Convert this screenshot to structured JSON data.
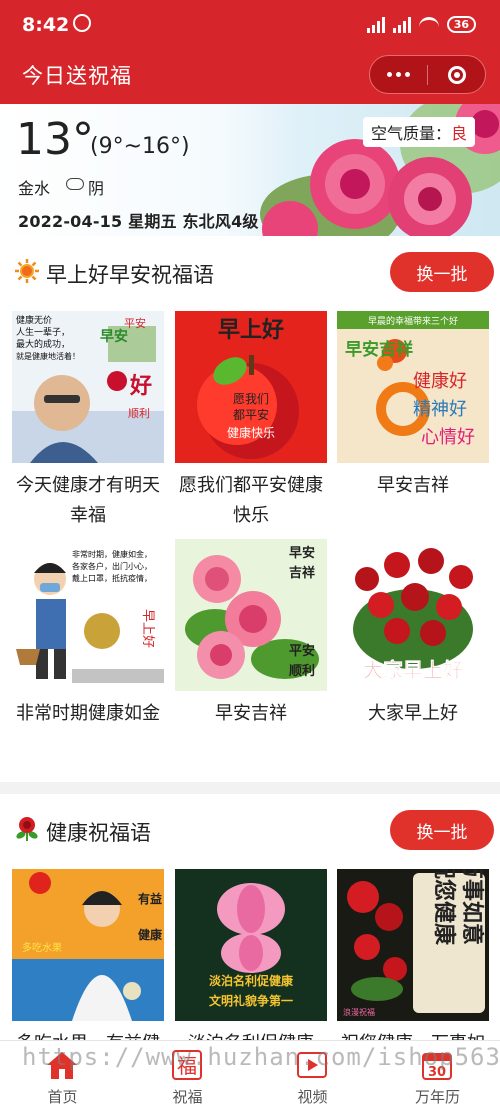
{
  "status": {
    "time": "8:42",
    "battery": "36"
  },
  "nav": {
    "title": "今日送祝福"
  },
  "weather": {
    "temp": "13°",
    "range": "(9°~16°)",
    "location": "金水",
    "condition": "阴",
    "date_line": "2022-04-15  星期五  东北风4级",
    "aq_label": "空气质量：",
    "aq_value": "良"
  },
  "sections": [
    {
      "title": "早上好早安祝福语",
      "more": "换一批",
      "items": [
        {
          "caption": "今天健康才有明天幸福",
          "art_text": [
            "健康无价",
            "人生一辈子，",
            "最大的成功，",
            "就是健康地活着！",
            "早安",
            "平安",
            "顺利",
            "好"
          ]
        },
        {
          "caption": "愿我们都平安健康快乐",
          "art_text": [
            "早上好",
            "愿我们",
            "都平安",
            "健康快乐"
          ]
        },
        {
          "caption": "早安吉祥",
          "art_text": [
            "早晨的幸福带来三个好",
            "早安吉祥",
            "健康好",
            "精神好",
            "心情好"
          ]
        },
        {
          "caption": "非常时期健康如金",
          "art_text": [
            "非常时期，健康如金，",
            "各家各户，出门小心，",
            "戴上口罩，抵抗疫情，",
            "早上好"
          ]
        },
        {
          "caption": "早安吉祥",
          "art_text": [
            "早安",
            "吉祥",
            "平安",
            "顺利"
          ]
        },
        {
          "caption": "大家早上好",
          "art_text": [
            "大家早上好"
          ]
        }
      ]
    },
    {
      "title": "健康祝福语",
      "more": "换一批",
      "items": [
        {
          "caption": "多吃水果，有益健康",
          "art_text": [
            "有益",
            "健康",
            "多吃水果"
          ]
        },
        {
          "caption": "淡泊名利促健康",
          "art_text": [
            "淡泊名利促健康",
            "文明礼貌争第一"
          ]
        },
        {
          "caption": "祝您健康，万事如意",
          "art_text": [
            "祝您健康",
            "万事如意",
            "浪漫祝福"
          ]
        }
      ]
    }
  ],
  "tabs": [
    {
      "label": "首页",
      "icon": "home-icon"
    },
    {
      "label": "祝福",
      "icon": "blessing-icon",
      "glyph": "福"
    },
    {
      "label": "视频",
      "icon": "video-icon"
    },
    {
      "label": "万年历",
      "icon": "calendar-icon",
      "glyph": "30"
    }
  ],
  "watermark": "https://www.huzhan.com/ishop5634",
  "colors": {
    "brand_red": "#d7262b",
    "button_red": "#e0312b"
  }
}
